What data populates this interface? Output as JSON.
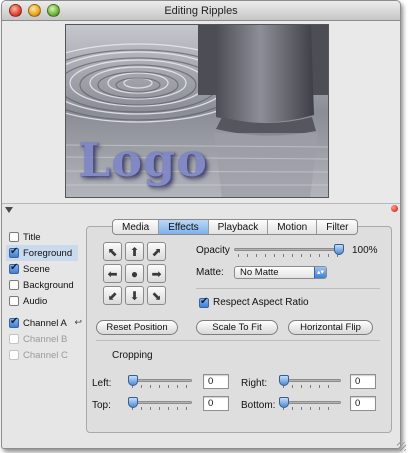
{
  "window": {
    "title": "Editing Ripples"
  },
  "preview": {
    "logo_text": "Logo"
  },
  "layers": [
    {
      "label": "Title",
      "checked": false,
      "selected": false,
      "enabled": true
    },
    {
      "label": "Foreground",
      "checked": true,
      "selected": true,
      "enabled": true
    },
    {
      "label": "Scene",
      "checked": true,
      "selected": false,
      "enabled": true
    },
    {
      "label": "Background",
      "checked": false,
      "selected": false,
      "enabled": true
    },
    {
      "label": "Audio",
      "checked": false,
      "selected": false,
      "enabled": true
    },
    {
      "label": "Channel A",
      "checked": true,
      "selected": false,
      "enabled": true
    },
    {
      "label": "Channel B",
      "checked": false,
      "selected": false,
      "enabled": false
    },
    {
      "label": "Channel C",
      "checked": false,
      "selected": false,
      "enabled": false
    }
  ],
  "tabs": [
    "Media",
    "Effects",
    "Playback",
    "Motion",
    "Filter"
  ],
  "active_tab": "Effects",
  "position_buttons": [
    "arrow-up-left-icon",
    "arrow-up-icon",
    "arrow-up-right-icon",
    "arrow-left-icon",
    "center-dot-icon",
    "arrow-right-icon",
    "arrow-down-left-icon",
    "arrow-down-icon",
    "arrow-down-right-icon"
  ],
  "effects": {
    "opacity_label": "Opacity",
    "opacity_value": "100%",
    "opacity_fraction": 1.0,
    "matte_label": "Matte:",
    "matte_value": "No Matte",
    "aspect_label": "Respect Aspect Ratio",
    "aspect_checked": true,
    "reset_label": "Reset Position",
    "scale_label": "Scale To Fit",
    "flip_label": "Horizontal Flip"
  },
  "cropping": {
    "title": "Cropping",
    "left_label": "Left:",
    "left_value": "0",
    "right_label": "Right:",
    "right_value": "0",
    "top_label": "Top:",
    "top_value": "0",
    "bottom_label": "Bottom:",
    "bottom_value": "0"
  },
  "colors": {
    "accent": "#7fb0ea",
    "selection": "#c9d9ee",
    "logo": "#7b82c8"
  }
}
